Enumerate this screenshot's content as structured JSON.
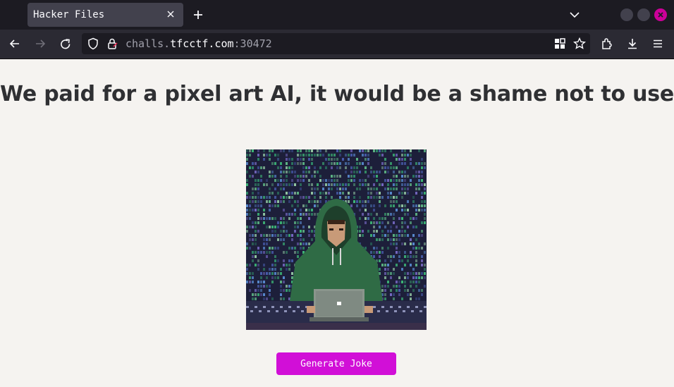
{
  "browser": {
    "tab_title": "Hacker Files",
    "url_prefix": "challs.",
    "url_host": "tfcctf.com",
    "url_suffix": ":30472"
  },
  "page": {
    "heading": "We paid for a pixel art AI, it would be a shame not to use it.",
    "button_label": "Generate Joke",
    "image": {
      "description_icon": "hacker-pixel-art-image",
      "colors": {
        "background": "#1d1f3a",
        "rain_green": "#3fbf7a",
        "hoodie": "#2f6b45",
        "laptop": "#8a958c"
      }
    }
  },
  "colors": {
    "accent": "#d10fd7",
    "window_close": "#cc0099",
    "toolbar": "#2b2a33",
    "tabbar": "#1c1b22"
  },
  "icons": [
    "close-icon",
    "plus-icon",
    "chevron-down-icon",
    "back-arrow-icon",
    "forward-arrow-icon",
    "reload-icon",
    "shield-icon",
    "lock-icon",
    "qr-icon",
    "star-icon",
    "extensions-icon",
    "download-icon",
    "menu-icon"
  ]
}
